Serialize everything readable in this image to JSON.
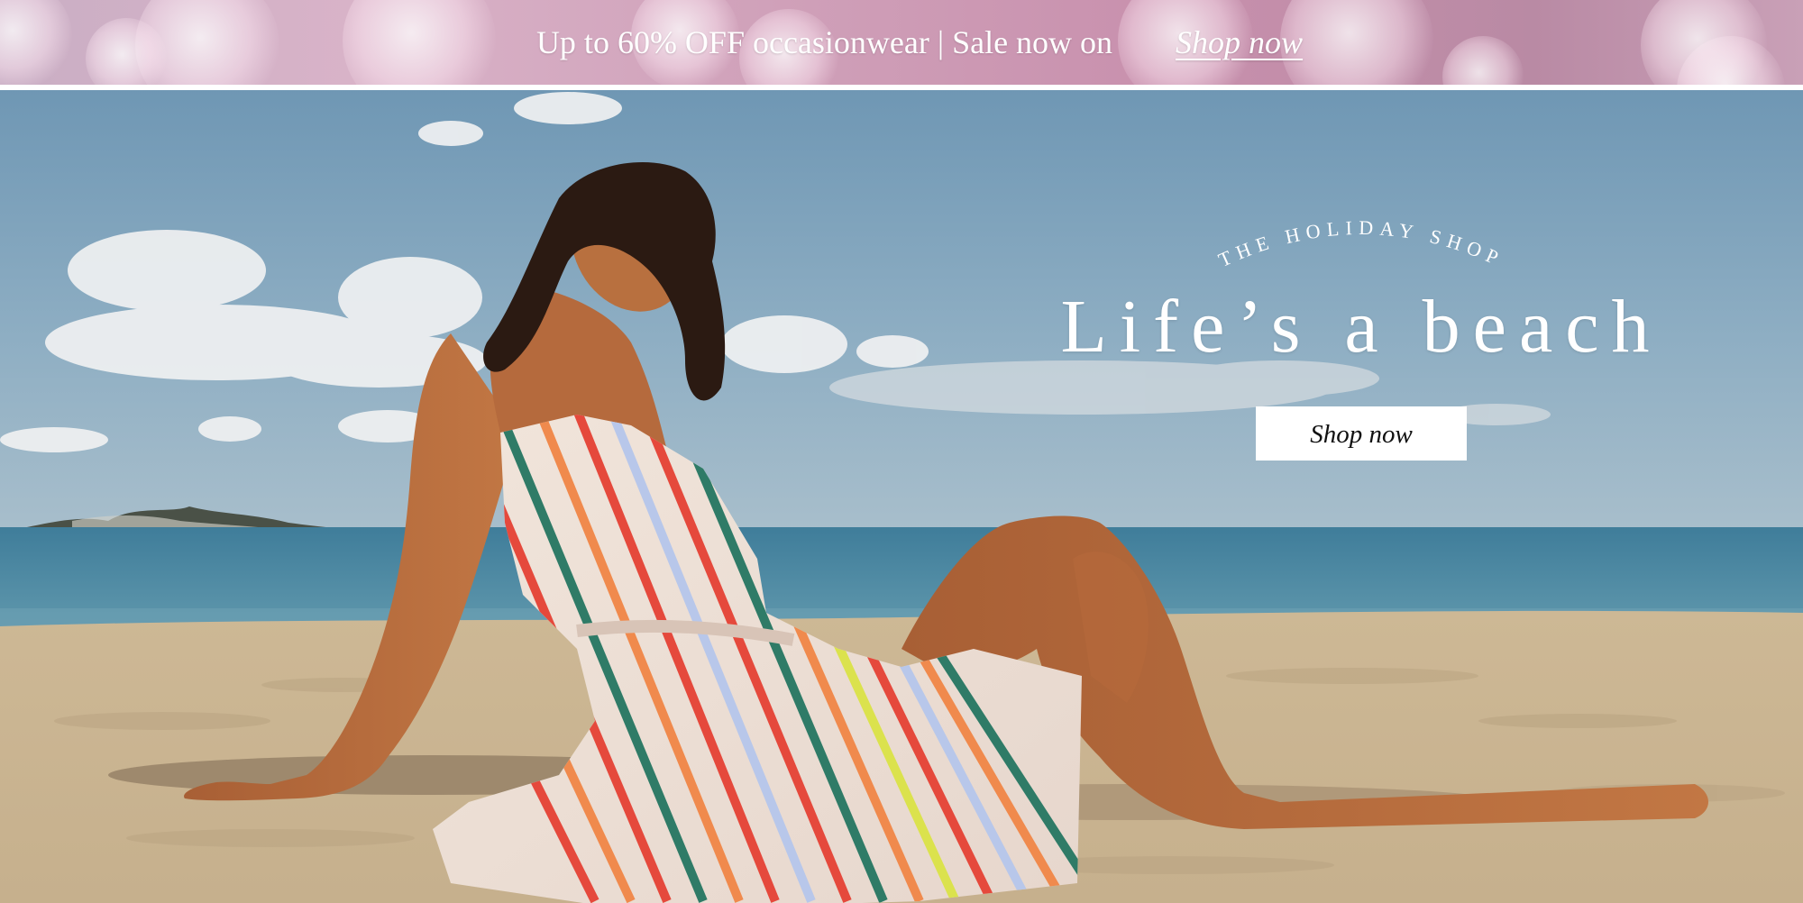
{
  "announcement": {
    "text": "Up to 60% OFF occasionwear | Sale now on",
    "link_label": "Shop now"
  },
  "hero": {
    "eyebrow": "THE HOLIDAY SHOP",
    "title": "Life’s a beach",
    "cta_label": "Shop now",
    "image_alt": "photo of a woman in a striped dress sitting on a beach"
  },
  "icons": {
    "hero_photo": "photo-image"
  },
  "colors": {
    "announcement_bg": "#cf9fb8",
    "text_on_image": "#ffffff",
    "button_bg": "#ffffff",
    "button_text": "#111111"
  }
}
